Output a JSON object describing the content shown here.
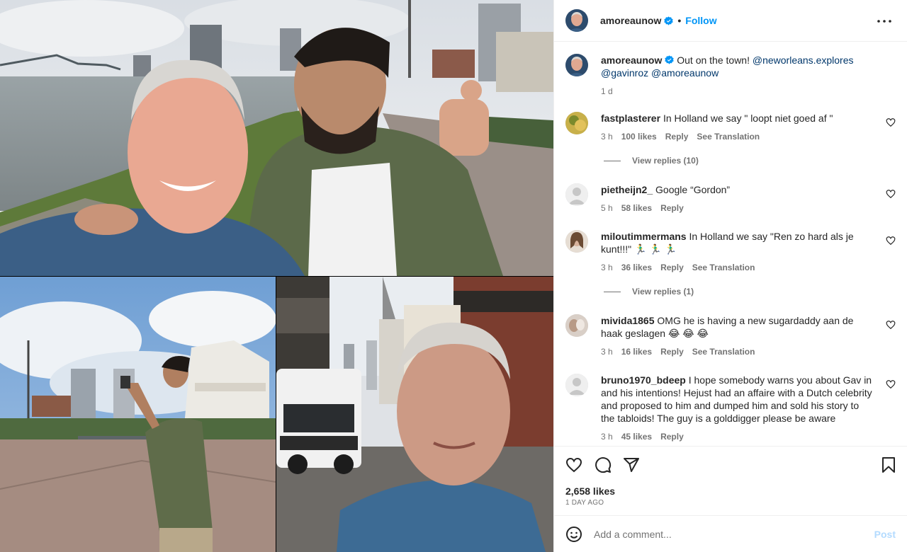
{
  "post": {
    "username": "amoreaunow",
    "follow_label": "Follow",
    "caption_text": "Out on the town!",
    "caption_mentions": [
      "@neworleans.explores",
      "@gavinroz",
      "@amoreaunow"
    ],
    "caption_time": "1 d",
    "likes": "2,658 likes",
    "date": "1 DAY AGO"
  },
  "comments": [
    {
      "user": "fastplasterer",
      "text": "In Holland we say \" loopt niet goed af \"",
      "time": "3 h",
      "likes": "100 likes",
      "reply": "Reply",
      "translate": "See Translation",
      "view_replies": "View replies (10)"
    },
    {
      "user": "pietheijn2_",
      "text": "Google “Gordon”",
      "time": "5 h",
      "likes": "58 likes",
      "reply": "Reply"
    },
    {
      "user": "miloutimmermans",
      "text": "In Holland we say \"Ren zo hard als je kunt!!!\" 🏃‍♂️ 🏃‍♂️ 🏃‍♂️",
      "time": "3 h",
      "likes": "36 likes",
      "reply": "Reply",
      "translate": "See Translation",
      "view_replies": "View replies (1)"
    },
    {
      "user": "mivida1865",
      "text": "OMG he is having a new sugardaddy aan de haak geslagen 😂 😂 😂",
      "time": "3 h",
      "likes": "16 likes",
      "reply": "Reply",
      "translate": "See Translation"
    },
    {
      "user": "bruno1970_bdeep",
      "text": "I hope somebody warns you about Gav in and his intentions! Hejust had an affaire with a Dutch celebrity and proposed to him and dumped him and sold his story to the tabloids! The guy is a golddigger please be aware",
      "time": "3 h",
      "likes": "45 likes",
      "reply": "Reply"
    }
  ],
  "add_comment": {
    "placeholder": "Add a comment...",
    "post_label": "Post"
  },
  "icons": [
    "more-icon",
    "verified-icon",
    "heart-icon",
    "comment-icon",
    "share-icon",
    "bookmark-icon",
    "emoji-icon"
  ],
  "colors": {
    "accent": "#0095f6",
    "mention": "#00376b",
    "muted": "#737373",
    "border": "#efefef",
    "post_disabled": "#b3dbff"
  }
}
